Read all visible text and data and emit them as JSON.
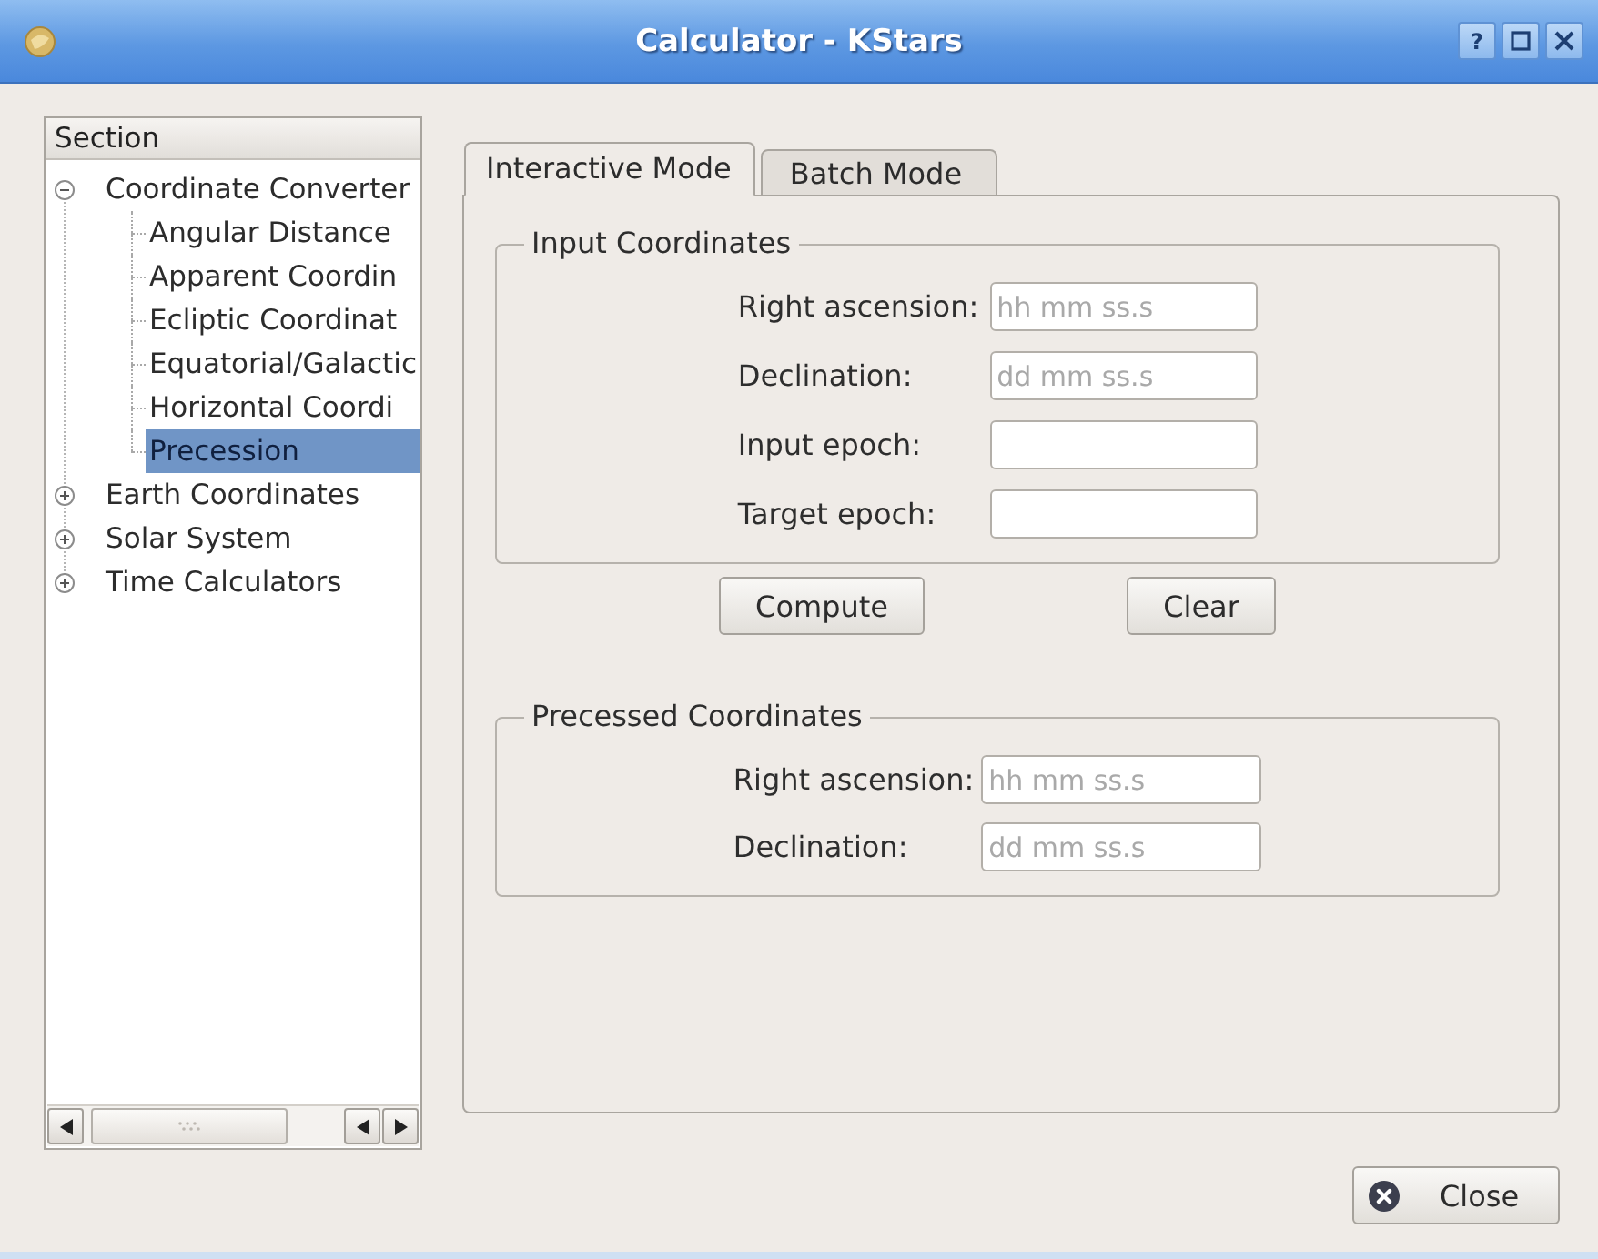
{
  "window": {
    "title": "Calculator - KStars",
    "help_button": "?"
  },
  "sidebar": {
    "header": "Section",
    "items": [
      {
        "label": "Coordinate Converter",
        "expanded": true,
        "selected": false,
        "children": [
          {
            "label": "Angular Distance",
            "selected": false
          },
          {
            "label": "Apparent Coordin",
            "selected": false
          },
          {
            "label": "Ecliptic Coordinat",
            "selected": false
          },
          {
            "label": "Equatorial/Galactic",
            "selected": false
          },
          {
            "label": "Horizontal Coordi",
            "selected": false
          },
          {
            "label": "Precession",
            "selected": true
          }
        ]
      },
      {
        "label": "Earth Coordinates",
        "expanded": false,
        "selected": false
      },
      {
        "label": "Solar System",
        "expanded": false,
        "selected": false
      },
      {
        "label": "Time Calculators",
        "expanded": false,
        "selected": false
      }
    ]
  },
  "tabs": [
    {
      "label": "Interactive Mode",
      "selected": true
    },
    {
      "label": "Batch Mode",
      "selected": false
    }
  ],
  "input_coordinates": {
    "title": "Input Coordinates",
    "fields": [
      {
        "label": "Right ascension:",
        "placeholder": "hh mm ss.s"
      },
      {
        "label": "Declination:",
        "placeholder": "dd mm ss.s"
      },
      {
        "label": "Input epoch:"
      },
      {
        "label": "Target epoch:"
      }
    ]
  },
  "actions": {
    "compute": "Compute",
    "clear": "Clear"
  },
  "precessed_coordinates": {
    "title": "Precessed Coordinates",
    "fields": [
      {
        "label": "Right ascension:",
        "placeholder": "hh mm ss.s"
      },
      {
        "label": "Declination:",
        "placeholder": "dd mm ss.s"
      }
    ]
  },
  "close_button": "Close"
}
